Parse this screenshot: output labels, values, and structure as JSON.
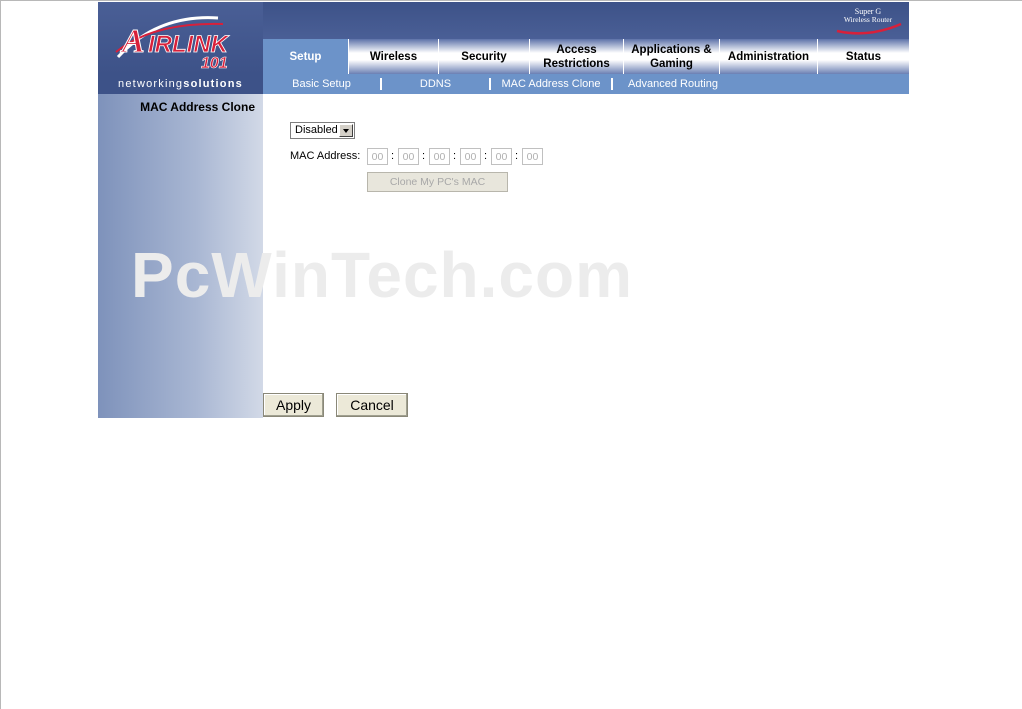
{
  "logo": {
    "brand": "AirLink 101",
    "tagline_light": "networking",
    "tagline_bold": "solutions"
  },
  "product_badge": {
    "line1": "Super G",
    "line2": "Wireless Router"
  },
  "tabs": [
    {
      "label": "Setup",
      "active": true
    },
    {
      "label": "Wireless"
    },
    {
      "label": "Security"
    },
    {
      "label": "Access Restrictions"
    },
    {
      "label": "Applications & Gaming"
    },
    {
      "label": "Administration"
    },
    {
      "label": "Status"
    }
  ],
  "subnav": [
    {
      "label": "Basic Setup"
    },
    {
      "label": "DDNS"
    },
    {
      "label": "MAC Address Clone",
      "active": true
    },
    {
      "label": "Advanced Routing"
    }
  ],
  "sidebar": {
    "title": "MAC Address Clone"
  },
  "form": {
    "mode_value": "Disabled",
    "mac_label": "MAC Address:",
    "mac_octets": [
      "00",
      "00",
      "00",
      "00",
      "00",
      "00"
    ],
    "mac_separator": ":",
    "clone_button": "Clone My PC's MAC"
  },
  "watermark": "PcWinTech.com",
  "actions": {
    "apply": "Apply",
    "cancel": "Cancel"
  },
  "colors": {
    "header_navy": "#3d5288",
    "active_blue": "#6c93c9",
    "logo_red": "#d8203a"
  }
}
